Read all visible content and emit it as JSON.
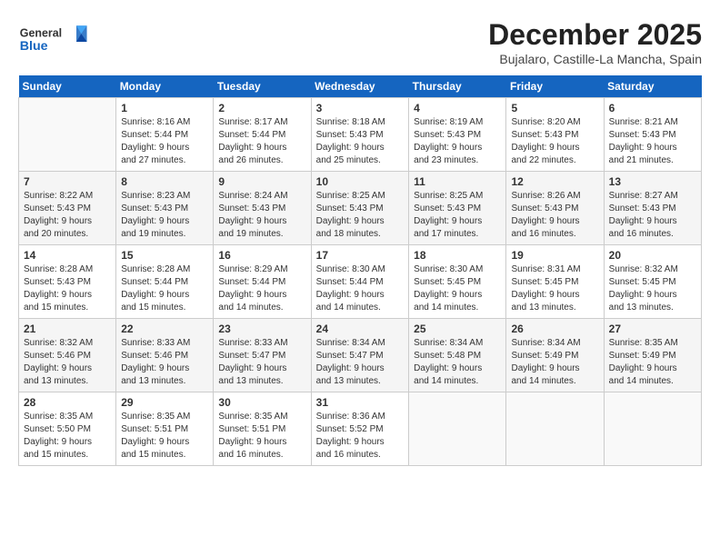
{
  "header": {
    "logo_general": "General",
    "logo_blue": "Blue",
    "month": "December 2025",
    "location": "Bujalaro, Castille-La Mancha, Spain"
  },
  "weekdays": [
    "Sunday",
    "Monday",
    "Tuesday",
    "Wednesday",
    "Thursday",
    "Friday",
    "Saturday"
  ],
  "weeks": [
    [
      {
        "day": "",
        "info": ""
      },
      {
        "day": "1",
        "info": "Sunrise: 8:16 AM\nSunset: 5:44 PM\nDaylight: 9 hours\nand 27 minutes."
      },
      {
        "day": "2",
        "info": "Sunrise: 8:17 AM\nSunset: 5:44 PM\nDaylight: 9 hours\nand 26 minutes."
      },
      {
        "day": "3",
        "info": "Sunrise: 8:18 AM\nSunset: 5:43 PM\nDaylight: 9 hours\nand 25 minutes."
      },
      {
        "day": "4",
        "info": "Sunrise: 8:19 AM\nSunset: 5:43 PM\nDaylight: 9 hours\nand 23 minutes."
      },
      {
        "day": "5",
        "info": "Sunrise: 8:20 AM\nSunset: 5:43 PM\nDaylight: 9 hours\nand 22 minutes."
      },
      {
        "day": "6",
        "info": "Sunrise: 8:21 AM\nSunset: 5:43 PM\nDaylight: 9 hours\nand 21 minutes."
      }
    ],
    [
      {
        "day": "7",
        "info": "Sunrise: 8:22 AM\nSunset: 5:43 PM\nDaylight: 9 hours\nand 20 minutes."
      },
      {
        "day": "8",
        "info": "Sunrise: 8:23 AM\nSunset: 5:43 PM\nDaylight: 9 hours\nand 19 minutes."
      },
      {
        "day": "9",
        "info": "Sunrise: 8:24 AM\nSunset: 5:43 PM\nDaylight: 9 hours\nand 19 minutes."
      },
      {
        "day": "10",
        "info": "Sunrise: 8:25 AM\nSunset: 5:43 PM\nDaylight: 9 hours\nand 18 minutes."
      },
      {
        "day": "11",
        "info": "Sunrise: 8:25 AM\nSunset: 5:43 PM\nDaylight: 9 hours\nand 17 minutes."
      },
      {
        "day": "12",
        "info": "Sunrise: 8:26 AM\nSunset: 5:43 PM\nDaylight: 9 hours\nand 16 minutes."
      },
      {
        "day": "13",
        "info": "Sunrise: 8:27 AM\nSunset: 5:43 PM\nDaylight: 9 hours\nand 16 minutes."
      }
    ],
    [
      {
        "day": "14",
        "info": "Sunrise: 8:28 AM\nSunset: 5:43 PM\nDaylight: 9 hours\nand 15 minutes."
      },
      {
        "day": "15",
        "info": "Sunrise: 8:28 AM\nSunset: 5:44 PM\nDaylight: 9 hours\nand 15 minutes."
      },
      {
        "day": "16",
        "info": "Sunrise: 8:29 AM\nSunset: 5:44 PM\nDaylight: 9 hours\nand 14 minutes."
      },
      {
        "day": "17",
        "info": "Sunrise: 8:30 AM\nSunset: 5:44 PM\nDaylight: 9 hours\nand 14 minutes."
      },
      {
        "day": "18",
        "info": "Sunrise: 8:30 AM\nSunset: 5:45 PM\nDaylight: 9 hours\nand 14 minutes."
      },
      {
        "day": "19",
        "info": "Sunrise: 8:31 AM\nSunset: 5:45 PM\nDaylight: 9 hours\nand 13 minutes."
      },
      {
        "day": "20",
        "info": "Sunrise: 8:32 AM\nSunset: 5:45 PM\nDaylight: 9 hours\nand 13 minutes."
      }
    ],
    [
      {
        "day": "21",
        "info": "Sunrise: 8:32 AM\nSunset: 5:46 PM\nDaylight: 9 hours\nand 13 minutes."
      },
      {
        "day": "22",
        "info": "Sunrise: 8:33 AM\nSunset: 5:46 PM\nDaylight: 9 hours\nand 13 minutes."
      },
      {
        "day": "23",
        "info": "Sunrise: 8:33 AM\nSunset: 5:47 PM\nDaylight: 9 hours\nand 13 minutes."
      },
      {
        "day": "24",
        "info": "Sunrise: 8:34 AM\nSunset: 5:47 PM\nDaylight: 9 hours\nand 13 minutes."
      },
      {
        "day": "25",
        "info": "Sunrise: 8:34 AM\nSunset: 5:48 PM\nDaylight: 9 hours\nand 14 minutes."
      },
      {
        "day": "26",
        "info": "Sunrise: 8:34 AM\nSunset: 5:49 PM\nDaylight: 9 hours\nand 14 minutes."
      },
      {
        "day": "27",
        "info": "Sunrise: 8:35 AM\nSunset: 5:49 PM\nDaylight: 9 hours\nand 14 minutes."
      }
    ],
    [
      {
        "day": "28",
        "info": "Sunrise: 8:35 AM\nSunset: 5:50 PM\nDaylight: 9 hours\nand 15 minutes."
      },
      {
        "day": "29",
        "info": "Sunrise: 8:35 AM\nSunset: 5:51 PM\nDaylight: 9 hours\nand 15 minutes."
      },
      {
        "day": "30",
        "info": "Sunrise: 8:35 AM\nSunset: 5:51 PM\nDaylight: 9 hours\nand 16 minutes."
      },
      {
        "day": "31",
        "info": "Sunrise: 8:36 AM\nSunset: 5:52 PM\nDaylight: 9 hours\nand 16 minutes."
      },
      {
        "day": "",
        "info": ""
      },
      {
        "day": "",
        "info": ""
      },
      {
        "day": "",
        "info": ""
      }
    ]
  ]
}
